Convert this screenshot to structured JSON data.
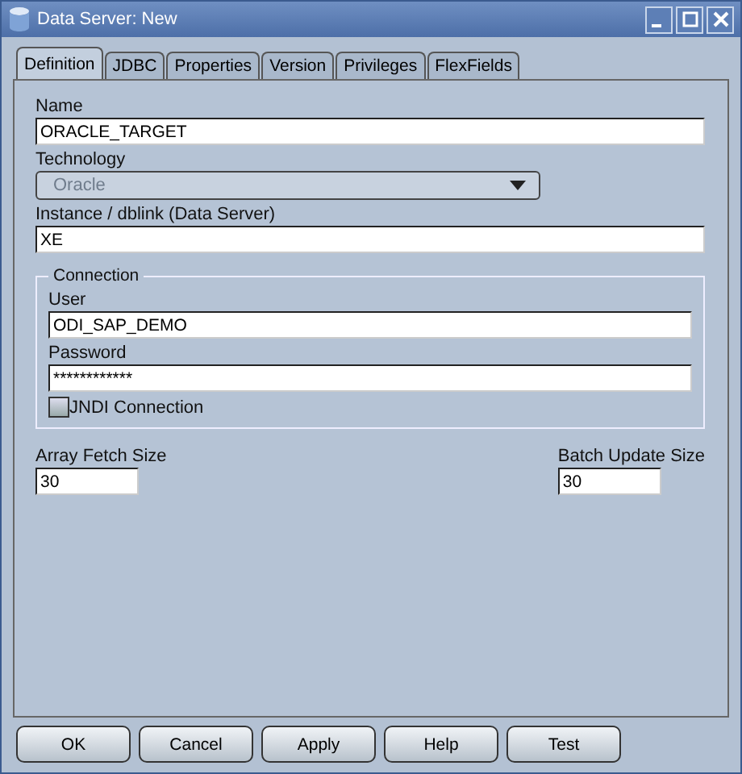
{
  "window": {
    "title": "Data Server: New"
  },
  "tabs": [
    {
      "label": "Definition",
      "selected": true
    },
    {
      "label": "JDBC",
      "selected": false
    },
    {
      "label": "Properties",
      "selected": false
    },
    {
      "label": "Version",
      "selected": false
    },
    {
      "label": "Privileges",
      "selected": false
    },
    {
      "label": "FlexFields",
      "selected": false
    }
  ],
  "name": {
    "label": "Name",
    "value": "ORACLE_TARGET"
  },
  "technology": {
    "label": "Technology",
    "value": "Oracle",
    "disabled": true
  },
  "instance": {
    "label": "Instance / dblink (Data Server)",
    "value": "XE"
  },
  "connection": {
    "title": "Connection",
    "user": {
      "label": "User",
      "value": "ODI_SAP_DEMO"
    },
    "password": {
      "label": "Password",
      "value": "************"
    },
    "jndi": {
      "label": "JNDI Connection",
      "checked": false
    }
  },
  "array_fetch_size": {
    "label": "Array Fetch Size",
    "value": "30"
  },
  "batch_update_size": {
    "label": "Batch Update Size",
    "value": "30"
  },
  "buttons": [
    "OK",
    "Cancel",
    "Apply",
    "Help",
    "Test"
  ]
}
